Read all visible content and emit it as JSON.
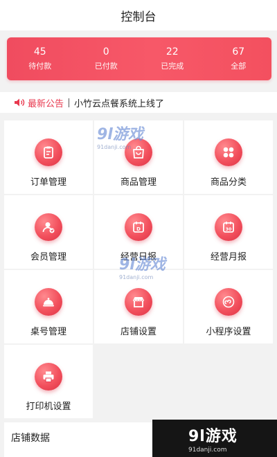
{
  "header": {
    "title": "控制台"
  },
  "stats": [
    {
      "value": "45",
      "label": "待付款"
    },
    {
      "value": "0",
      "label": "已付款"
    },
    {
      "value": "22",
      "label": "已完成"
    },
    {
      "value": "67",
      "label": "全部"
    }
  ],
  "notice": {
    "tag": "最新公告",
    "message": "小竹云点餐系统上线了"
  },
  "menu": [
    {
      "label": "订单管理",
      "icon": "clipboard-icon"
    },
    {
      "label": "商品管理",
      "icon": "shopping-bag-icon"
    },
    {
      "label": "商品分类",
      "icon": "category-grid-icon"
    },
    {
      "label": "会员管理",
      "icon": "member-icon"
    },
    {
      "label": "经营日报",
      "icon": "daily-report-icon",
      "day_mark": "D"
    },
    {
      "label": "经营月报",
      "icon": "monthly-report-icon",
      "day_mark": "30"
    },
    {
      "label": "桌号管理",
      "icon": "table-bell-icon"
    },
    {
      "label": "店铺设置",
      "icon": "shop-icon"
    },
    {
      "label": "小程序设置",
      "icon": "mini-program-icon"
    },
    {
      "label": "打印机设置",
      "icon": "printer-icon"
    }
  ],
  "section": {
    "title": "店铺数据"
  },
  "watermark": {
    "brand": "9l游戏",
    "site": "91danji.com"
  },
  "colors": {
    "accent": "#f04c5f",
    "notice_tag": "#e8384e",
    "watermark": "#6c8ed6"
  }
}
